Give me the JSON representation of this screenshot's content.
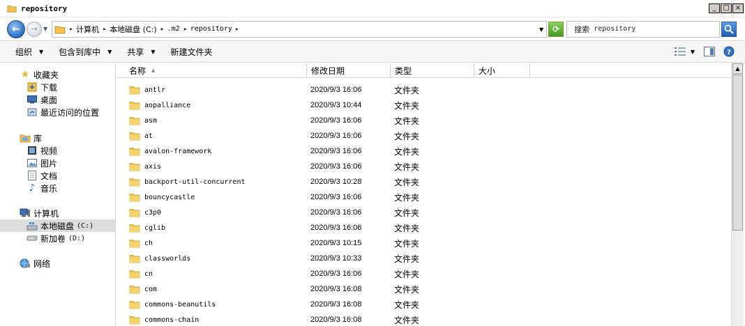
{
  "window": {
    "title": "repository",
    "controls": {
      "minimize": "_",
      "maximize": "□",
      "close": "×"
    }
  },
  "address": {
    "crumbs": [
      {
        "label": "计算机",
        "mono": false
      },
      {
        "label": "本地磁盘 (C:)",
        "mono": false
      },
      {
        "label": ".m2",
        "mono": true
      },
      {
        "label": "repository",
        "mono": true
      }
    ],
    "search_label": "搜索",
    "search_target": "repository"
  },
  "toolbar": {
    "organize": "组织",
    "include_in_library": "包含到库中",
    "share": "共享",
    "new_folder": "新建文件夹"
  },
  "nav": {
    "favorites": {
      "label": "收藏夹",
      "items": [
        "下载",
        "桌面",
        "最近访问的位置"
      ]
    },
    "libraries": {
      "label": "库",
      "items": [
        "视频",
        "图片",
        "文档",
        "音乐"
      ]
    },
    "computer": {
      "label": "计算机",
      "drives": [
        {
          "name": "本地磁盘",
          "letter": "(C:)"
        },
        {
          "name": "新加卷",
          "letter": "(D:)"
        }
      ]
    },
    "network": {
      "label": "网络"
    }
  },
  "columns": {
    "name": "名称",
    "date": "修改日期",
    "type": "类型",
    "size": "大小"
  },
  "files": [
    {
      "name": "antlr",
      "date": "2020/9/3 16:06",
      "type": "文件夹"
    },
    {
      "name": "aopalliance",
      "date": "2020/9/3 10:44",
      "type": "文件夹"
    },
    {
      "name": "asm",
      "date": "2020/9/3 16:06",
      "type": "文件夹"
    },
    {
      "name": "at",
      "date": "2020/9/3 16:06",
      "type": "文件夹"
    },
    {
      "name": "avalon-framework",
      "date": "2020/9/3 16:06",
      "type": "文件夹"
    },
    {
      "name": "axis",
      "date": "2020/9/3 16:06",
      "type": "文件夹"
    },
    {
      "name": "backport-util-concurrent",
      "date": "2020/9/3 10:28",
      "type": "文件夹"
    },
    {
      "name": "bouncycastle",
      "date": "2020/9/3 16:06",
      "type": "文件夹"
    },
    {
      "name": "c3p0",
      "date": "2020/9/3 16:06",
      "type": "文件夹"
    },
    {
      "name": "cglib",
      "date": "2020/9/3 16:06",
      "type": "文件夹"
    },
    {
      "name": "ch",
      "date": "2020/9/3 10:15",
      "type": "文件夹"
    },
    {
      "name": "classworlds",
      "date": "2020/9/3 10:33",
      "type": "文件夹"
    },
    {
      "name": "cn",
      "date": "2020/9/3 16:06",
      "type": "文件夹"
    },
    {
      "name": "com",
      "date": "2020/9/3 16:08",
      "type": "文件夹"
    },
    {
      "name": "commons-beanutils",
      "date": "2020/9/3 16:08",
      "type": "文件夹"
    },
    {
      "name": "commons-chain",
      "date": "2020/9/3 16:08",
      "type": "文件夹"
    }
  ],
  "icons": {
    "folder": "folder-icon",
    "back": "back-arrow-icon",
    "forward": "forward-arrow-icon",
    "refresh": "refresh-icon",
    "search": "search-icon"
  },
  "colors": {
    "folder": "#f2c24d",
    "selection": "#dddddd",
    "back_button": "#2b6fc2"
  }
}
